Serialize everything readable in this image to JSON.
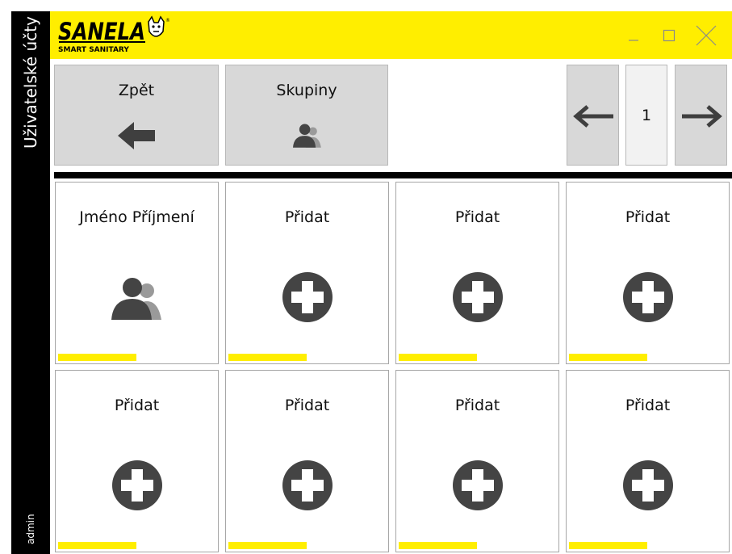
{
  "sidebar": {
    "title": "Uživatelské účty",
    "user": "admin"
  },
  "brand": {
    "name": "SANELA",
    "tagline": "SMART SANITARY",
    "registered": "®"
  },
  "window_controls": {
    "minimize_icon": "minimize-icon",
    "maximize_icon": "maximize-icon",
    "close_icon": "close-icon"
  },
  "toolbar": {
    "back_label": "Zpět",
    "groups_label": "Skupiny"
  },
  "pagination": {
    "current_page": "1"
  },
  "tiles": [
    {
      "label": "Jméno Příjmení",
      "icon": "users-icon"
    },
    {
      "label": "Přidat",
      "icon": "add-icon"
    },
    {
      "label": "Přidat",
      "icon": "add-icon"
    },
    {
      "label": "Přidat",
      "icon": "add-icon"
    },
    {
      "label": "Přidat",
      "icon": "add-icon"
    },
    {
      "label": "Přidat",
      "icon": "add-icon"
    },
    {
      "label": "Přidat",
      "icon": "add-icon"
    },
    {
      "label": "Přidat",
      "icon": "add-icon"
    }
  ],
  "colors": {
    "accent": "#ffee00",
    "sidebar": "#000000",
    "button": "#d8d8d8",
    "icon": "#444444"
  }
}
